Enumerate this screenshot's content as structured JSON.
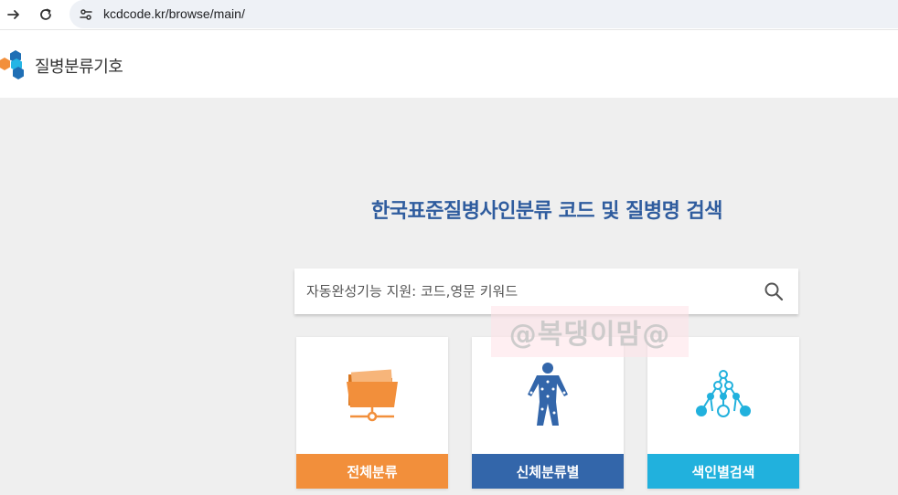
{
  "browser": {
    "url": "kcdcode.kr/browse/main/"
  },
  "header": {
    "logo_text": "질병분류기호"
  },
  "main": {
    "title": "한국표준질병사인분류 코드 및 질병명 검색",
    "search": {
      "placeholder": "자동완성기능 지원: 코드,영문 키워드"
    },
    "watermark": "@복댕이맘@",
    "cards": [
      {
        "label": "전체분류",
        "color": "#f28f3b",
        "icon": "folder-network-icon"
      },
      {
        "label": "신체분류별",
        "color": "#3366aa",
        "icon": "human-body-icon"
      },
      {
        "label": "색인별검색",
        "color": "#21b1dd",
        "icon": "tree-nodes-icon"
      }
    ]
  },
  "colors": {
    "title": "#2f5c9e",
    "background": "#efefef",
    "logo_orange": "#f28f3b",
    "logo_blue": "#1f6fb5",
    "logo_cyan": "#26b5e5"
  }
}
